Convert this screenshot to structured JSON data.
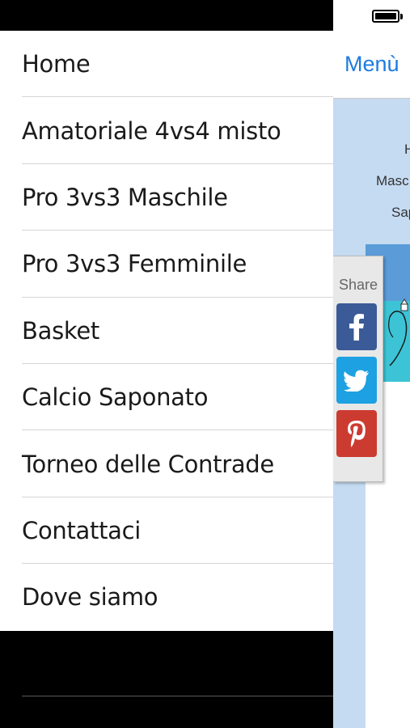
{
  "menu": {
    "items": [
      {
        "label": "Home"
      },
      {
        "label": "Amatoriale 4vs4 misto"
      },
      {
        "label": "Pro 3vs3 Maschile"
      },
      {
        "label": "Pro 3vs3 Femminile"
      },
      {
        "label": "Basket"
      },
      {
        "label": "Calcio Saponato"
      },
      {
        "label": "Torneo delle Contrade"
      },
      {
        "label": "Contattaci"
      },
      {
        "label": "Dove siamo"
      }
    ]
  },
  "nav": {
    "menu_button_label": "Menù"
  },
  "content": {
    "line1": "H",
    "line2": "Masc",
    "line3": "Sap"
  },
  "share": {
    "label": "Share",
    "buttons": [
      {
        "icon": "facebook-icon",
        "color": "#3b5a98"
      },
      {
        "icon": "twitter-icon",
        "color": "#1da1e2"
      },
      {
        "icon": "pinterest-icon",
        "color": "#cc3b30"
      }
    ]
  },
  "colors": {
    "link_blue": "#1d7be0",
    "content_bg": "#c5dbf2"
  }
}
